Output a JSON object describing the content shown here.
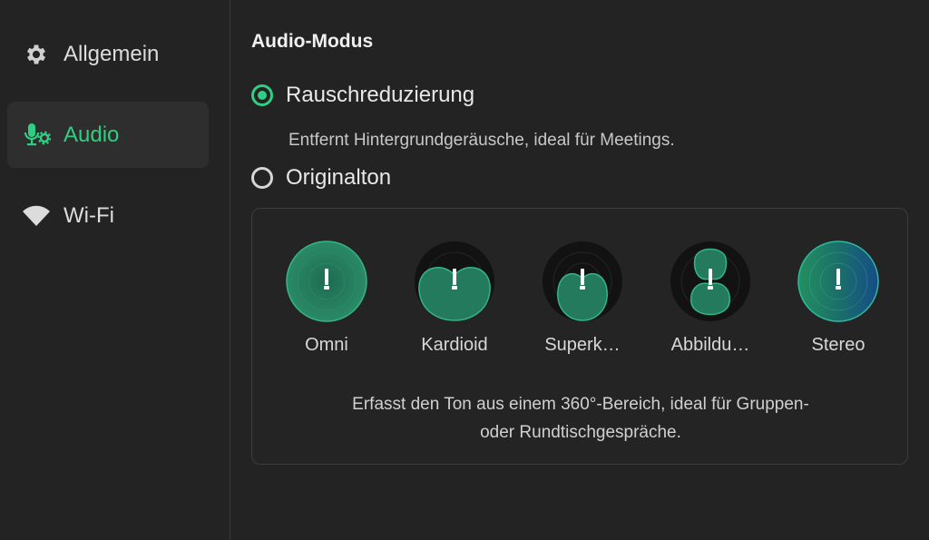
{
  "sidebar": {
    "items": [
      {
        "label": "Allgemein",
        "icon": "gear-icon"
      },
      {
        "label": "Audio",
        "icon": "microphone-settings-icon",
        "active": true
      },
      {
        "label": "Wi-Fi",
        "icon": "wifi-icon"
      }
    ]
  },
  "main": {
    "section_title": "Audio-Modus",
    "options": [
      {
        "label": "Rauschreduzierung",
        "selected": true,
        "description": "Entfernt Hintergrundgeräusche, ideal für Meetings."
      },
      {
        "label": "Originalton",
        "selected": false
      }
    ],
    "pickup_modes": [
      {
        "label": "Omni",
        "icon": "omni-pattern-icon"
      },
      {
        "label": "Kardioid",
        "icon": "cardioid-pattern-icon"
      },
      {
        "label": "Superk…",
        "icon": "supercardioid-pattern-icon"
      },
      {
        "label": "Abbildu…",
        "icon": "figure-eight-pattern-icon"
      },
      {
        "label": "Stereo",
        "icon": "stereo-pattern-icon"
      }
    ],
    "pickup_description_line1": "Erfasst den Ton aus einem 360°-Bereich, ideal für Gruppen-",
    "pickup_description_line2": "oder Rundtischgespräche."
  },
  "colors": {
    "accent": "#2fce83",
    "background": "#232323",
    "active_item": "#2e2e2e"
  }
}
